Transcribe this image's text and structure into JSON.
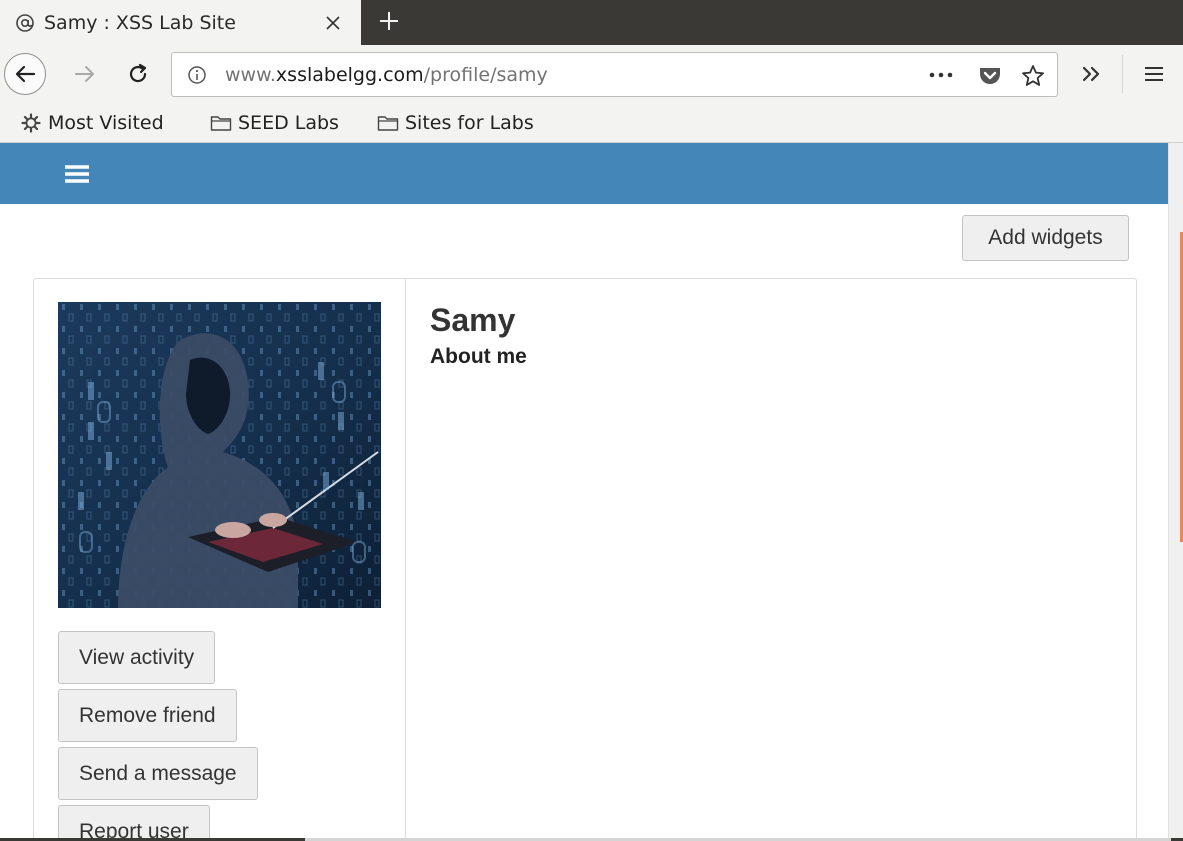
{
  "browser": {
    "tab": {
      "title": "Samy : XSS Lab Site",
      "favicon": "globe-at-icon"
    },
    "icons": {
      "close": "close-icon",
      "new_tab": "plus-icon",
      "back": "back-arrow-icon",
      "forward": "forward-arrow-icon",
      "reload": "reload-icon",
      "info": "info-icon",
      "page_actions": "ellipsis-icon",
      "pocket": "pocket-icon",
      "bookmark": "star-icon",
      "overflow": "double-chevron-icon",
      "menu": "hamburger-menu-icon"
    },
    "url": {
      "prefix": "www.",
      "host": "xsslabelgg.com",
      "path": "/profile/samy"
    },
    "bookmarks": [
      {
        "label": "Most Visited",
        "icon": "gear-icon"
      },
      {
        "label": "SEED Labs",
        "icon": "folder-icon"
      },
      {
        "label": "Sites for Labs",
        "icon": "folder-icon"
      }
    ]
  },
  "site": {
    "header_color": "#4386b7",
    "menu_icon": "hamburger-icon",
    "add_widgets_label": "Add widgets",
    "profile": {
      "name": "Samy",
      "about_heading": "About me",
      "avatar": "hooded-hacker-with-laptop-avatar",
      "actions": [
        {
          "label": "View activity"
        },
        {
          "label": "Remove friend"
        },
        {
          "label": "Send a message"
        },
        {
          "label": "Report user"
        }
      ]
    }
  }
}
